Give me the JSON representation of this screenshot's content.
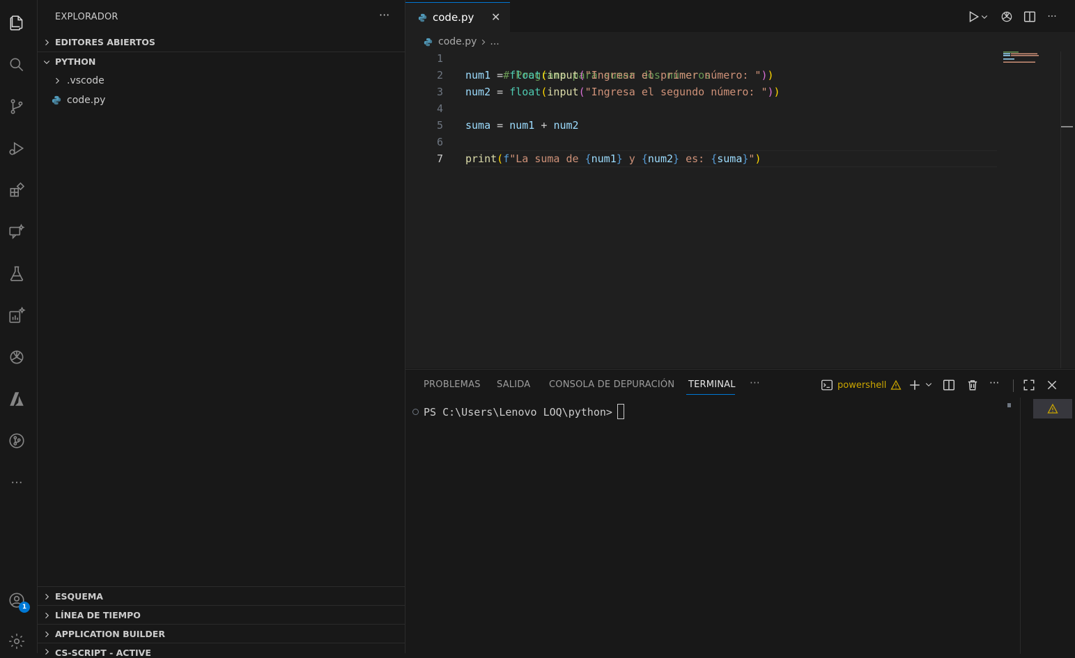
{
  "sidebar": {
    "title": "EXPLORADOR",
    "more": "···",
    "sections": {
      "open_editors": "EDITORES ABIERTOS",
      "folder": "PYTHON",
      "outline": "ESQUEMA",
      "timeline": "LÍNEA DE TIEMPO",
      "app_builder": "APPLICATION BUILDER",
      "cs_script": "CS-SCRIPT - ACTIVE"
    },
    "tree": [
      {
        "label": ".vscode",
        "type": "folder"
      },
      {
        "label": "code.py",
        "type": "python-file"
      }
    ]
  },
  "activity": {
    "accounts_badge": "1",
    "more": "···"
  },
  "editor": {
    "tab": {
      "label": "code.py",
      "close": "✕"
    },
    "breadcrumb": {
      "file": "code.py",
      "rest": "..."
    },
    "active_line": 7,
    "lines": {
      "n1": "1",
      "n2": "2",
      "n3": "3",
      "n4": "4",
      "n5": "5",
      "n6": "6",
      "n7": "7",
      "l1": "# Programa para sumar dos números",
      "l2_var": "num1",
      "l2_eq": " = ",
      "l2_fn": "float",
      "l2_p1": "(",
      "l2_in": "input",
      "l2_p2": "(",
      "l2_str": "\"Ingresa el primer número: \"",
      "l2_p3": ")",
      "l2_p4": ")",
      "l3_var": "num2",
      "l3_eq": " = ",
      "l3_fn": "float",
      "l3_p1": "(",
      "l3_in": "input",
      "l3_p2": "(",
      "l3_str": "\"Ingresa el segundo número: \"",
      "l3_p3": ")",
      "l3_p4": ")",
      "l5_var": "suma",
      "l5_eq": " = ",
      "l5_a": "num1",
      "l5_plus": " + ",
      "l5_b": "num2",
      "l7_fn": "print",
      "l7_p1": "(",
      "l7_f": "f",
      "l7_s1": "\"La suma de ",
      "l7_b1": "{",
      "l7_v1": "num1",
      "l7_b2": "}",
      "l7_s2": " y ",
      "l7_b3": "{",
      "l7_v2": "num2",
      "l7_b4": "}",
      "l7_s3": " es: ",
      "l7_b5": "{",
      "l7_v3": "suma",
      "l7_b6": "}",
      "l7_s4": "\"",
      "l7_p2": ")"
    }
  },
  "panel": {
    "tabs": [
      "PROBLEMAS",
      "SALIDA",
      "CONSOLA DE DEPURACIÓN",
      "TERMINAL"
    ],
    "active_tab": "TERMINAL",
    "more": "···",
    "terminal_name": "powershell",
    "prompt": "PS C:\\Users\\Lenovo LOQ\\python> "
  },
  "colors": {
    "accent": "#0078d4",
    "warning": "#cca700",
    "python_icon": "#519aba"
  }
}
